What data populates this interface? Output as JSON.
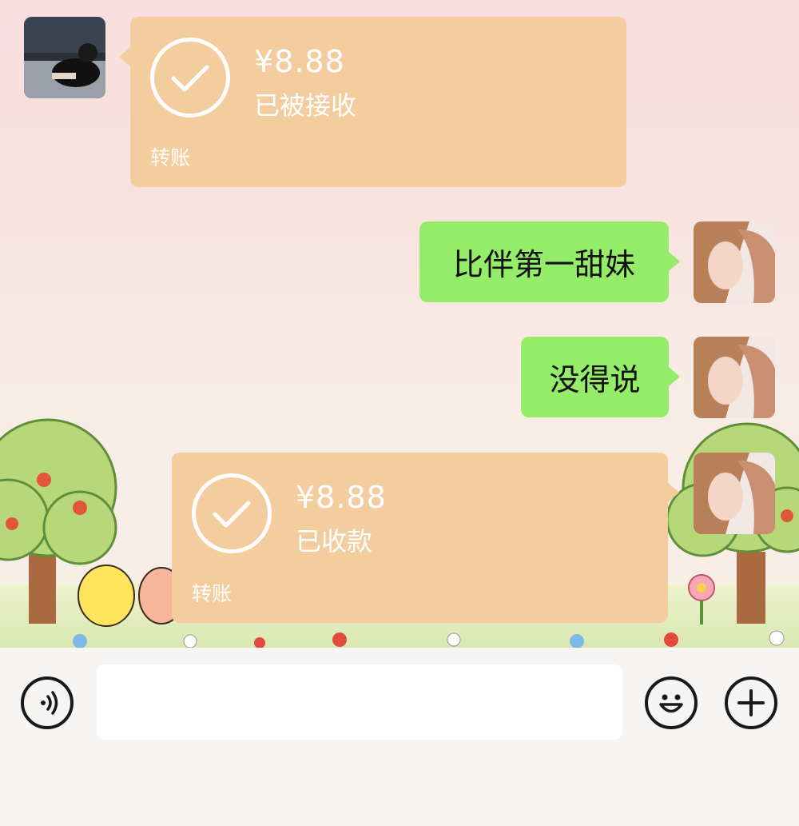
{
  "messages": [
    {
      "sender": "other",
      "type": "transfer",
      "amount": "¥8.88",
      "status": "已被接收",
      "label": "转账"
    },
    {
      "sender": "self",
      "type": "text",
      "text": "比伴第一甜妹"
    },
    {
      "sender": "self",
      "type": "text",
      "text": "没得说"
    },
    {
      "sender": "self",
      "type": "transfer",
      "amount": "¥8.88",
      "status": "已收款",
      "label": "转账"
    }
  ],
  "input_bar": {
    "voice_icon": "voice-icon",
    "input_value": "",
    "emoji_icon": "emoji-icon",
    "plus_icon": "plus-icon"
  },
  "colors": {
    "transfer_bubble": "#f4cd9f",
    "text_bubble": "#95ec69",
    "input_bar_bg": "#f6f5f4"
  }
}
